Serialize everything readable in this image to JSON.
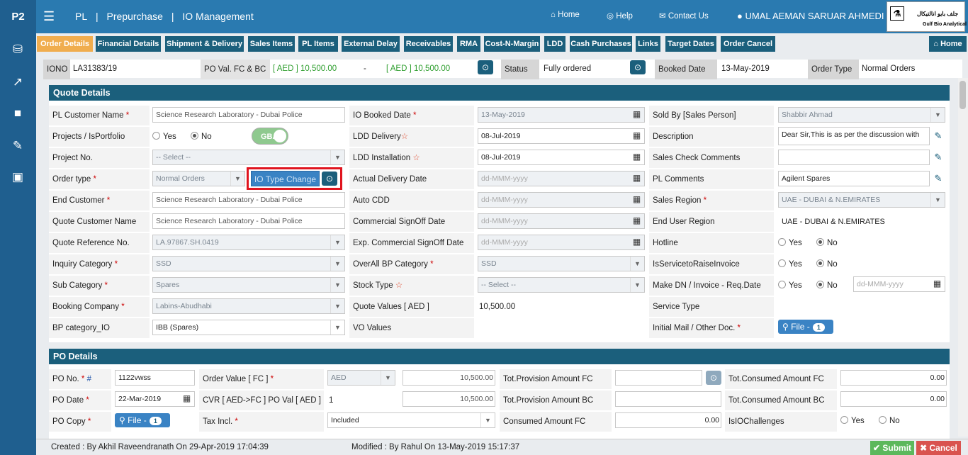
{
  "topbar": {
    "app_logo": "P2",
    "breadcrumb": [
      "PL",
      "|",
      "Prepurchase",
      "|",
      "IO Management"
    ],
    "nav": {
      "home": "Home",
      "help": "Help",
      "contact": "Contact Us",
      "user": "UMAL AEMAN SARUAR AHMEDI"
    },
    "brand_arabic": "جلف بايو انالتيكال",
    "brand_name": "Gulf Bio Analytical"
  },
  "sidebar_icons": [
    "database-icon",
    "chart-icon",
    "truck-icon",
    "wrench-icon",
    "money-icon"
  ],
  "tabs": [
    "Order Details",
    "Financial Details",
    "Shipment & Delivery",
    "Sales Items",
    "PL Items",
    "External Delay",
    "Receivables",
    "RMA",
    "Cost-N-Margin",
    "LDD",
    "Cash Purchases",
    "Links",
    "Target Dates",
    "Order Cancel"
  ],
  "home_button": "Home",
  "infobar": {
    "iono_label": "IONO",
    "iono_value": "LA31383/19",
    "po_label": "PO Val. FC & BC",
    "po_fc": "[ AED ] 10,500.00",
    "dash": "-",
    "po_bc": "[ AED ] 10,500.00",
    "status_label": "Status",
    "status_value": "Fully ordered",
    "booked_label": "Booked Date",
    "booked_value": "13-May-2019",
    "order_type_label": "Order Type",
    "order_type_value": "Normal Orders"
  },
  "quote": {
    "title": "Quote Details",
    "pl_customer_name": {
      "label": "PL Customer Name",
      "value": "Science Research Laboratory - Dubai Police"
    },
    "projects": {
      "label": "Projects / IsPortfolio",
      "yes": "Yes",
      "no": "No",
      "toggle": "GBA"
    },
    "project_no": {
      "label": "Project No.",
      "value": "-- Select --"
    },
    "order_type": {
      "label": "Order type",
      "value": "Normal Orders",
      "button": "IO Type Change"
    },
    "end_customer": {
      "label": "End Customer",
      "value": "Science Research Laboratory - Dubai Police"
    },
    "quote_customer_name": {
      "label": "Quote Customer Name",
      "value": "Science Research Laboratory - Dubai Police"
    },
    "quote_ref": {
      "label": "Quote Reference No.",
      "value": "LA.97867.SH.0419"
    },
    "inquiry_category": {
      "label": "Inquiry Category",
      "value": "SSD"
    },
    "sub_category": {
      "label": "Sub Category",
      "value": "Spares"
    },
    "booking_company": {
      "label": "Booking Company",
      "value": "Labins-Abudhabi"
    },
    "bp_category": {
      "label": "BP category_IO",
      "value": "IBB (Spares)"
    },
    "io_booked_date": {
      "label": "IO Booked Date",
      "value": "13-May-2019"
    },
    "ldd_delivery": {
      "label": "LDD Delivery",
      "value": "08-Jul-2019"
    },
    "ldd_installation": {
      "label": "LDD Installation",
      "value": "08-Jul-2019"
    },
    "actual_delivery": {
      "label": "Actual Delivery Date",
      "placeholder": "dd-MMM-yyyy"
    },
    "auto_cdd": {
      "label": "Auto CDD",
      "placeholder": "dd-MMM-yyyy"
    },
    "commercial_signoff": {
      "label": "Commercial SignOff Date",
      "placeholder": "dd-MMM-yyyy"
    },
    "exp_commercial_signoff": {
      "label": "Exp. Commercial SignOff Date",
      "placeholder": "dd-MMM-yyyy"
    },
    "overall_bp": {
      "label": "OverAll BP Category",
      "value": "SSD"
    },
    "stock_type": {
      "label": "Stock Type",
      "value": "-- Select --"
    },
    "quote_values": {
      "label": "Quote Values [ AED ]",
      "value": "10,500.00"
    },
    "vo_values": {
      "label": "VO Values"
    },
    "sold_by": {
      "label": "Sold By [Sales Person]",
      "value": "Shabbir Ahmad"
    },
    "description": {
      "label": "Description",
      "value": "Dear Sir,This is as per the discussion with"
    },
    "sales_check_comments": {
      "label": "Sales Check Comments",
      "value": ""
    },
    "pl_comments": {
      "label": "PL Comments",
      "value": "Agilent Spares"
    },
    "sales_region": {
      "label": "Sales Region",
      "value": "UAE - DUBAI & N.EMIRATES"
    },
    "end_user_region": {
      "label": "End User Region",
      "value": "UAE - DUBAI & N.EMIRATES"
    },
    "hotline": {
      "label": "Hotline",
      "yes": "Yes",
      "no": "No"
    },
    "is_service": {
      "label": "IsServicetoRaiseInvoice",
      "yes": "Yes",
      "no": "No"
    },
    "make_dn": {
      "label": "Make DN / Invoice - Req.Date",
      "yes": "Yes",
      "no": "No",
      "placeholder": "dd-MMM-yyyy"
    },
    "service_type": {
      "label": "Service Type"
    },
    "initial_mail": {
      "label": "Initial Mail / Other Doc.",
      "button": "File -",
      "count": "1"
    }
  },
  "po": {
    "title": "PO Details",
    "po_no": {
      "label": "PO No.",
      "hash": "#",
      "value": "1122vwss"
    },
    "po_date": {
      "label": "PO Date",
      "value": "22-Mar-2019"
    },
    "po_copy": {
      "label": "PO Copy",
      "button": "File -",
      "count": "1"
    },
    "order_value": {
      "label": "Order Value [ FC ]",
      "currency": "AED",
      "amount": "10,500.00"
    },
    "cvr": {
      "label": "CVR [ AED->FC ] PO Val [ AED ]",
      "value": "1",
      "amount": "10,500.00"
    },
    "tax_incl": {
      "label": "Tax Incl.",
      "value": "Included"
    },
    "tot_prov_fc": {
      "label": "Tot.Provision Amount FC",
      "value": ""
    },
    "tot_prov_bc": {
      "label": "Tot.Provision Amount BC",
      "value": ""
    },
    "consumed_fc": {
      "label": "Consumed Amount FC",
      "value": "0.00"
    },
    "tot_consumed_fc": {
      "label": "Tot.Consumed Amount FC",
      "value": "0.00"
    },
    "tot_consumed_bc": {
      "label": "Tot.Consumed Amount BC",
      "value": "0.00"
    },
    "is_challenges": {
      "label": "IsIOChallenges",
      "yes": "Yes",
      "no": "No"
    }
  },
  "footer": {
    "created": "Created : By Akhil Raveendranath On 29-Apr-2019 17:04:39",
    "modified": "Modified : By Rahul On 13-May-2019 15:17:37",
    "submit": "Submit",
    "cancel": "Cancel"
  },
  "colors": {
    "topbar": "#2a7ab0",
    "sidebar": "#1f5f8f",
    "tab": "#1b5f7c",
    "active_tab": "#f0ad4e",
    "highlight": "#e0141e",
    "submit": "#5cb85c",
    "cancel": "#d9534f"
  }
}
